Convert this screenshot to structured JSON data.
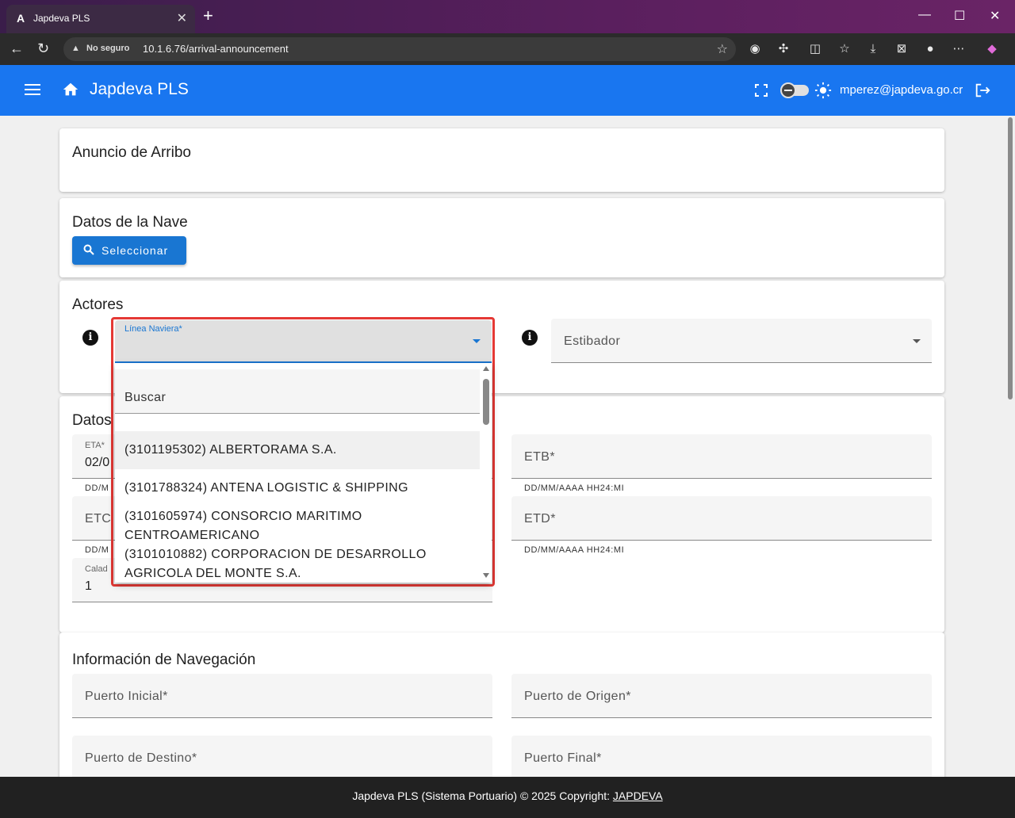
{
  "browser": {
    "tab_title": "Japdeva PLS",
    "tab_favicon": "A",
    "security_label": "No seguro",
    "url": "10.1.6.76/arrival-announcement"
  },
  "header": {
    "app_title": "Japdeva PLS",
    "user_email": "mperez@japdeva.go.cr",
    "brand_color": "#1976f0"
  },
  "page": {
    "title": "Anuncio de Arribo"
  },
  "nave": {
    "title": "Datos de la Nave",
    "select_button": "Seleccionar"
  },
  "actores": {
    "title": "Actores",
    "linea_naviera_label": "Línea Naviera*",
    "estibador_label": "Estibador",
    "search_placeholder": "Buscar",
    "options": [
      "(3101195302) ALBERTORAMA S.A.",
      "(3101788324) ANTENA LOGISTIC & SHIPPING",
      "(3101605974) CONSORCIO MARITIMO CENTROAMERICANO",
      "(3101010882) CORPORACION DE DESARROLLO AGRICOLA DEL MONTE S.A."
    ]
  },
  "datos": {
    "title_visible": "Datos",
    "eta_label": "ETA*",
    "eta_value": "02/0",
    "etb_label": "ETB*",
    "etc_label": "ETC",
    "etd_label": "ETD*",
    "calado_label": "Calad",
    "calado_value": "1",
    "hint_left": "DD/M",
    "hint_full": "DD/MM/AAAA HH24:MI"
  },
  "navegacion": {
    "title": "Información de Navegación",
    "puerto_inicial": "Puerto Inicial*",
    "puerto_origen": "Puerto de Origen*",
    "puerto_destino": "Puerto de Destino*",
    "puerto_final": "Puerto Final*"
  },
  "footer": {
    "text": "Japdeva PLS (Sistema Portuario) © 2025 Copyright:",
    "link": "JAPDEVA"
  }
}
